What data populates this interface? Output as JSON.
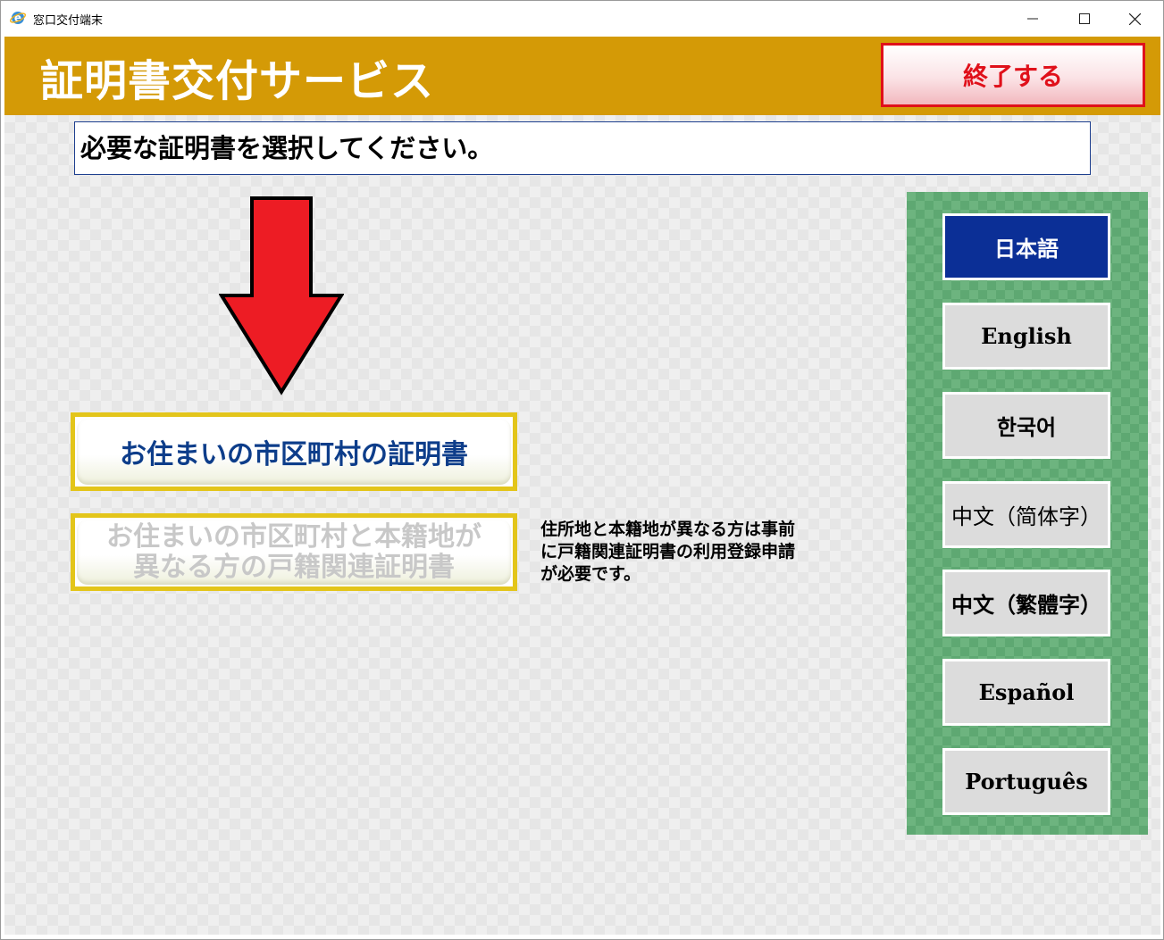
{
  "window": {
    "title": "窓口交付端末",
    "minimize_glyph": "—",
    "maximize_glyph": "☐",
    "close_glyph": "✕"
  },
  "header": {
    "title": "証明書交付サービス",
    "end_button_label": "終了する"
  },
  "instruction": "必要な証明書を選択してください。",
  "certificates": {
    "resident": "お住まいの市区町村の証明書",
    "family_register_line1": "お住まいの市区町村と本籍地が",
    "family_register_line2": "異なる方の戸籍関連証明書"
  },
  "note": {
    "line1": "住所地と本籍地が異なる方は事前",
    "line2": "に戸籍関連証明書の利用登録申請",
    "line3": "が必要です。"
  },
  "languages": [
    {
      "label": "日本語",
      "selected": true
    },
    {
      "label": "English",
      "selected": false
    },
    {
      "label": "한국어",
      "selected": false
    },
    {
      "label": "中文（简体字）",
      "selected": false
    },
    {
      "label": "中文（繁體字）",
      "selected": false
    },
    {
      "label": "Español",
      "selected": false
    },
    {
      "label": "Português",
      "selected": false
    }
  ],
  "colors": {
    "header_bg": "#d49a06",
    "end_button_text": "#e0101a",
    "arrow_fill": "#ed1c24",
    "selected_language_bg": "#0b2f96",
    "language_panel_bg": "#6db47f",
    "certificate_border": "#e3c51a",
    "certificate_text": "#0d3d8a"
  },
  "icons": {
    "app": "internet-explorer-icon",
    "indicator": "down-arrow-icon"
  }
}
